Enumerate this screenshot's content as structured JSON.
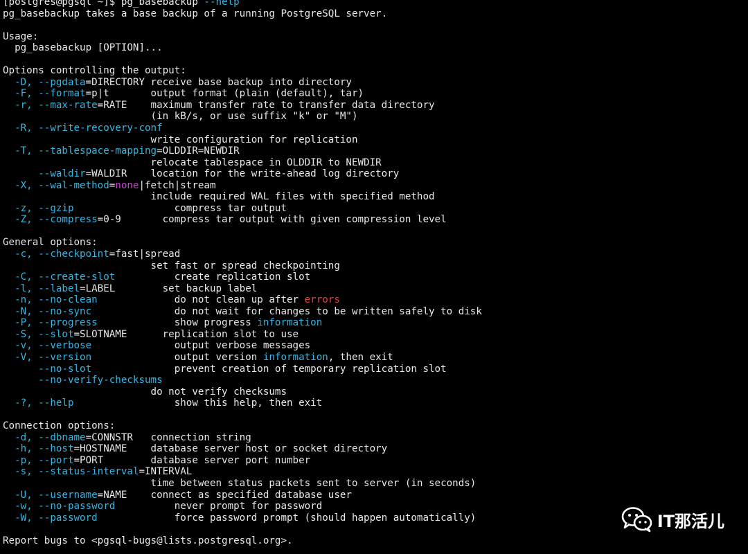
{
  "terminal": {
    "lines": [
      [
        {
          "t": "[postgres@pgsql ~]$ pg_basebackup ",
          "c": "cmd"
        },
        {
          "t": "--help",
          "c": "opt"
        }
      ],
      [
        {
          "t": "pg_basebackup takes a base backup of a running PostgreSQL server.",
          "c": "default"
        }
      ],
      [],
      [
        {
          "t": "Usage:",
          "c": "default"
        }
      ],
      [
        {
          "t": "  pg_basebackup [OPTION]...",
          "c": "default"
        }
      ],
      [],
      [
        {
          "t": "Options controlling the output:",
          "c": "default"
        }
      ],
      [
        {
          "t": "  -D, ",
          "c": "opt"
        },
        {
          "t": "--pgdata",
          "c": "opt"
        },
        {
          "t": "=DIRECTORY receive base backup into directory",
          "c": "default"
        }
      ],
      [
        {
          "t": "  -F, ",
          "c": "opt"
        },
        {
          "t": "--format",
          "c": "opt"
        },
        {
          "t": "=p|t       output format (plain (default), tar)",
          "c": "default"
        }
      ],
      [
        {
          "t": "  -r, ",
          "c": "opt"
        },
        {
          "t": "--max-rate",
          "c": "opt"
        },
        {
          "t": "=RATE    maximum transfer rate to transfer data directory",
          "c": "default"
        }
      ],
      [
        {
          "t": "                         (in kB/s, or use suffix \"k\" or \"M\")",
          "c": "default"
        }
      ],
      [
        {
          "t": "  -R, ",
          "c": "opt"
        },
        {
          "t": "--write-recovery-conf",
          "c": "opt"
        }
      ],
      [
        {
          "t": "                         write configuration for replication",
          "c": "default"
        }
      ],
      [
        {
          "t": "  -T, ",
          "c": "opt"
        },
        {
          "t": "--tablespace-mapping",
          "c": "opt"
        },
        {
          "t": "=OLDDIR=NEWDIR",
          "c": "default"
        }
      ],
      [
        {
          "t": "                         relocate tablespace in OLDDIR to NEWDIR",
          "c": "default"
        }
      ],
      [
        {
          "t": "      ",
          "c": "default"
        },
        {
          "t": "--waldir",
          "c": "opt"
        },
        {
          "t": "=WALDIR    location for the write-ahead log directory",
          "c": "default"
        }
      ],
      [
        {
          "t": "  -X, ",
          "c": "opt"
        },
        {
          "t": "--wal-method",
          "c": "opt"
        },
        {
          "t": "=",
          "c": "default"
        },
        {
          "t": "none",
          "c": "magenta"
        },
        {
          "t": "|fetch|stream",
          "c": "default"
        }
      ],
      [
        {
          "t": "                         include required WAL files with specified method",
          "c": "default"
        }
      ],
      [
        {
          "t": "  -z, ",
          "c": "opt"
        },
        {
          "t": "--gzip",
          "c": "opt"
        },
        {
          "t": "                 compress tar output",
          "c": "default"
        }
      ],
      [
        {
          "t": "  -Z, ",
          "c": "opt"
        },
        {
          "t": "--compress",
          "c": "opt"
        },
        {
          "t": "=0-9       compress tar output with given compression level",
          "c": "default"
        }
      ],
      [],
      [
        {
          "t": "General options:",
          "c": "default"
        }
      ],
      [
        {
          "t": "  -c, ",
          "c": "opt"
        },
        {
          "t": "--checkpoint",
          "c": "opt"
        },
        {
          "t": "=fast|spread",
          "c": "default"
        }
      ],
      [
        {
          "t": "                         set fast or spread checkpointing",
          "c": "default"
        }
      ],
      [
        {
          "t": "  -C, ",
          "c": "opt"
        },
        {
          "t": "--create-slot",
          "c": "opt"
        },
        {
          "t": "          create replication slot",
          "c": "default"
        }
      ],
      [
        {
          "t": "  -l, ",
          "c": "opt"
        },
        {
          "t": "--label",
          "c": "opt"
        },
        {
          "t": "=LABEL        set backup label",
          "c": "default"
        }
      ],
      [
        {
          "t": "  -n, ",
          "c": "opt"
        },
        {
          "t": "--no-clean",
          "c": "opt"
        },
        {
          "t": "             do not clean up after ",
          "c": "default"
        },
        {
          "t": "errors",
          "c": "red"
        }
      ],
      [
        {
          "t": "  -N, ",
          "c": "opt"
        },
        {
          "t": "--no-sync",
          "c": "opt"
        },
        {
          "t": "              do not wait for changes to be written safely to disk",
          "c": "default"
        }
      ],
      [
        {
          "t": "  -P, ",
          "c": "opt"
        },
        {
          "t": "--progress",
          "c": "opt"
        },
        {
          "t": "             show progress ",
          "c": "default"
        },
        {
          "t": "information",
          "c": "opt"
        }
      ],
      [
        {
          "t": "  -S, ",
          "c": "opt"
        },
        {
          "t": "--slot",
          "c": "opt"
        },
        {
          "t": "=SLOTNAME      replication slot to use",
          "c": "default"
        }
      ],
      [
        {
          "t": "  -v, ",
          "c": "opt"
        },
        {
          "t": "--verbose",
          "c": "opt"
        },
        {
          "t": "              output verbose messages",
          "c": "default"
        }
      ],
      [
        {
          "t": "  -V, ",
          "c": "opt"
        },
        {
          "t": "--version",
          "c": "opt"
        },
        {
          "t": "              output version ",
          "c": "default"
        },
        {
          "t": "information",
          "c": "opt"
        },
        {
          "t": ", then exit",
          "c": "default"
        }
      ],
      [
        {
          "t": "      ",
          "c": "default"
        },
        {
          "t": "--no-slot",
          "c": "opt"
        },
        {
          "t": "              prevent creation of temporary replication slot",
          "c": "default"
        }
      ],
      [
        {
          "t": "      ",
          "c": "default"
        },
        {
          "t": "--no-verify-checksums",
          "c": "opt"
        }
      ],
      [
        {
          "t": "                         do not verify checksums",
          "c": "default"
        }
      ],
      [
        {
          "t": "  -?, ",
          "c": "opt"
        },
        {
          "t": "--help",
          "c": "opt"
        },
        {
          "t": "                 show this help, then exit",
          "c": "default"
        }
      ],
      [],
      [
        {
          "t": "Connection options:",
          "c": "default"
        }
      ],
      [
        {
          "t": "  -d, ",
          "c": "opt"
        },
        {
          "t": "--dbname",
          "c": "opt"
        },
        {
          "t": "=CONNSTR   connection string",
          "c": "default"
        }
      ],
      [
        {
          "t": "  -h, ",
          "c": "opt"
        },
        {
          "t": "--host",
          "c": "opt"
        },
        {
          "t": "=HOSTNAME    database server host or socket directory",
          "c": "default"
        }
      ],
      [
        {
          "t": "  -p, ",
          "c": "opt"
        },
        {
          "t": "--port",
          "c": "opt"
        },
        {
          "t": "=PORT        database server port number",
          "c": "default"
        }
      ],
      [
        {
          "t": "  -s, ",
          "c": "opt"
        },
        {
          "t": "--status-interval",
          "c": "opt"
        },
        {
          "t": "=INTERVAL",
          "c": "default"
        }
      ],
      [
        {
          "t": "                         time between status packets sent to server (in seconds)",
          "c": "default"
        }
      ],
      [
        {
          "t": "  -U, ",
          "c": "opt"
        },
        {
          "t": "--username",
          "c": "opt"
        },
        {
          "t": "=NAME    connect as specified database user",
          "c": "default"
        }
      ],
      [
        {
          "t": "  -w, ",
          "c": "opt"
        },
        {
          "t": "--no-password",
          "c": "opt"
        },
        {
          "t": "          never prompt for password",
          "c": "default"
        }
      ],
      [
        {
          "t": "  -W, ",
          "c": "opt"
        },
        {
          "t": "--password",
          "c": "opt"
        },
        {
          "t": "             force password prompt (should happen automatically)",
          "c": "default"
        }
      ],
      [],
      [
        {
          "t": "Report bugs to <pgsql-bugs@lists.postgresql.org>.",
          "c": "default"
        }
      ]
    ]
  },
  "watermark": {
    "icon": "wechat-icon",
    "text": "IT那活儿"
  },
  "colors": {
    "background": "#000000",
    "text": "#e8e8e8",
    "option": "#2fb8e6",
    "error": "#e8413c",
    "highlight": "#d43ad4"
  }
}
